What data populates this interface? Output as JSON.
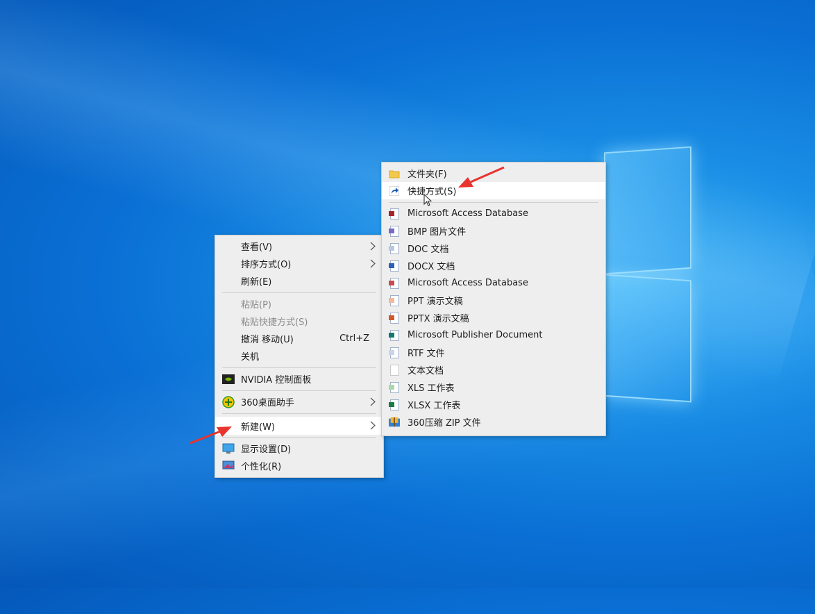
{
  "context_menu": {
    "items": [
      {
        "label": "查看(V)"
      },
      {
        "label": "排序方式(O)"
      },
      {
        "label": "刷新(E)"
      },
      {
        "label": "粘贴(P)"
      },
      {
        "label": "粘贴快捷方式(S)"
      },
      {
        "label": "撤消 移动(U)",
        "shortcut": "Ctrl+Z"
      },
      {
        "label": "关机"
      },
      {
        "label": "NVIDIA 控制面板"
      },
      {
        "label": "360桌面助手"
      },
      {
        "label": "新建(W)"
      },
      {
        "label": "显示设置(D)"
      },
      {
        "label": "个性化(R)"
      }
    ]
  },
  "new_submenu": {
    "items": [
      {
        "label": "文件夹(F)",
        "icon": "folder-icon"
      },
      {
        "label": "快捷方式(S)",
        "icon": "shortcut-icon"
      },
      {
        "label": "Microsoft Access Database",
        "icon": "access-icon"
      },
      {
        "label": "BMP 图片文件",
        "icon": "bmp-icon"
      },
      {
        "label": "DOC 文档",
        "icon": "doc-icon"
      },
      {
        "label": "DOCX 文档",
        "icon": "docx-icon"
      },
      {
        "label": "Microsoft Access Database",
        "icon": "access-icon"
      },
      {
        "label": "PPT 演示文稿",
        "icon": "ppt-icon"
      },
      {
        "label": "PPTX 演示文稿",
        "icon": "pptx-icon"
      },
      {
        "label": "Microsoft Publisher Document",
        "icon": "publisher-icon"
      },
      {
        "label": "RTF 文件",
        "icon": "rtf-icon"
      },
      {
        "label": "文本文档",
        "icon": "text-icon"
      },
      {
        "label": "XLS 工作表",
        "icon": "xls-icon"
      },
      {
        "label": "XLSX 工作表",
        "icon": "xlsx-icon"
      },
      {
        "label": "360压缩 ZIP 文件",
        "icon": "zip-icon"
      }
    ]
  },
  "colors": {
    "desktop": "#0a6fd4",
    "menu_bg": "#eeeeee",
    "highlight": "#ffffff",
    "annotation_arrow": "#e8332e"
  }
}
